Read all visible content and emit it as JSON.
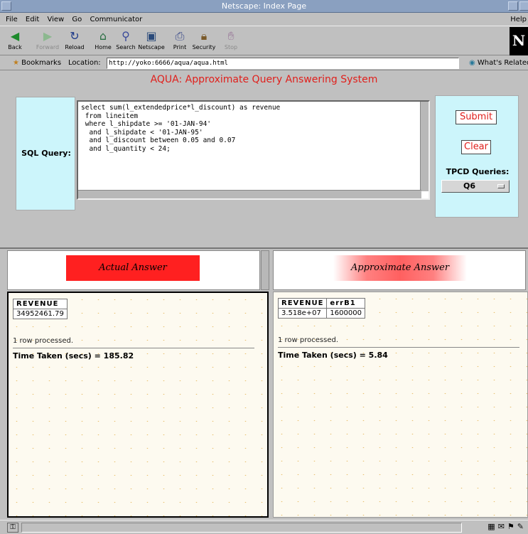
{
  "window": {
    "title": "Netscape: Index Page"
  },
  "menu": {
    "items": [
      "File",
      "Edit",
      "View",
      "Go",
      "Communicator"
    ],
    "help": "Help"
  },
  "toolbar": {
    "back": "Back",
    "forward": "Forward",
    "reload": "Reload",
    "home": "Home",
    "search": "Search",
    "netscape": "Netscape",
    "print": "Print",
    "security": "Security",
    "stop": "Stop"
  },
  "location": {
    "bookmarks": "Bookmarks",
    "label": "Location:",
    "url": "http://yoko:6666/aqua/aqua.html",
    "whats_related": "What's Related"
  },
  "app": {
    "title": "AQUA: Approximate Query Answering System",
    "sql_label": "SQL Query:",
    "sql_text": "select sum(l_extendedprice*l_discount) as revenue\n from lineitem\n where l_shipdate >= '01-JAN-94'\n  and l_shipdate < '01-JAN-95'\n  and l_discount between 0.05 and 0.07\n  and l_quantity < 24;",
    "submit": "Submit",
    "clear": "Clear",
    "tpcd_label": "TPCD Queries:",
    "tpcd_selected": "Q6"
  },
  "actual": {
    "banner": "Actual    Answer",
    "columns": [
      "REVENUE"
    ],
    "row": [
      "34952461.79"
    ],
    "rows_processed": "1 row processed.",
    "time_taken": "Time Taken (secs) = 185.82"
  },
  "approx": {
    "banner": "Approximate  Answer",
    "columns": [
      "REVENUE",
      "errB1"
    ],
    "row": [
      "3.518e+07",
      "1600000"
    ],
    "rows_processed": "1 row processed.",
    "time_taken": "Time Taken (secs) = 5.84"
  },
  "colors": {
    "accent_red": "#e0201c",
    "panel_cyan": "#ccf5fb",
    "title_bar": "#8aa0c0"
  },
  "icons": [
    "back-icon",
    "forward-icon",
    "reload-icon",
    "home-icon",
    "search-icon",
    "netscape-icon",
    "print-icon",
    "security-icon",
    "stop-icon",
    "bookmarks-icon",
    "location-icon",
    "lock-icon",
    "netscape-logo"
  ]
}
